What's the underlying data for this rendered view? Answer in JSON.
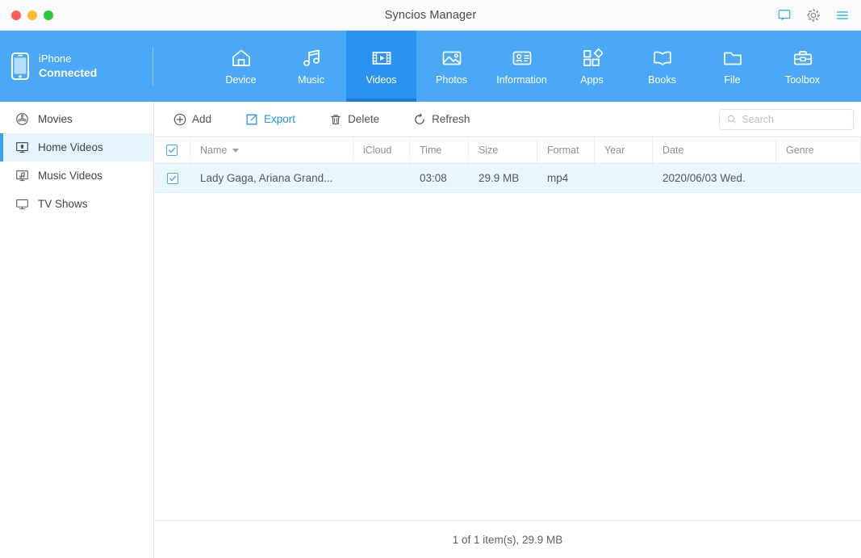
{
  "window": {
    "title": "Syncios Manager",
    "traffic_lights": [
      "close",
      "minimize",
      "maximize"
    ],
    "actions": [
      {
        "name": "feedback-icon",
        "label": "Feedback",
        "color": "#32b2f0"
      },
      {
        "name": "gear-icon",
        "label": "Settings",
        "color": "#8a9096"
      },
      {
        "name": "menu-icon",
        "label": "Menu",
        "color": "#32b2f0"
      }
    ]
  },
  "device": {
    "icon": "phone-icon",
    "name": "iPhone",
    "status": "Connected"
  },
  "nav": {
    "active": "Videos",
    "items": [
      {
        "label": "Device",
        "icon": "home-icon"
      },
      {
        "label": "Music",
        "icon": "music-note-icon"
      },
      {
        "label": "Videos",
        "icon": "film-icon"
      },
      {
        "label": "Photos",
        "icon": "picture-icon"
      },
      {
        "label": "Information",
        "icon": "contact-card-icon"
      },
      {
        "label": "Apps",
        "icon": "apps-grid-icon"
      },
      {
        "label": "Books",
        "icon": "book-icon"
      },
      {
        "label": "File",
        "icon": "folder-icon"
      },
      {
        "label": "Toolbox",
        "icon": "toolbox-icon"
      }
    ]
  },
  "sidebar": {
    "active": "Home Videos",
    "items": [
      {
        "label": "Movies",
        "icon": "film-reel-icon"
      },
      {
        "label": "Home Videos",
        "icon": "home-video-icon"
      },
      {
        "label": "Music Videos",
        "icon": "music-video-icon"
      },
      {
        "label": "TV Shows",
        "icon": "monitor-icon"
      }
    ]
  },
  "toolbar": {
    "add_label": "Add",
    "export_label": "Export",
    "delete_label": "Delete",
    "refresh_label": "Refresh"
  },
  "search": {
    "placeholder": "Search",
    "value": ""
  },
  "table": {
    "select_all_checked": true,
    "sort_column": "Name",
    "sort_direction": "desc",
    "columns": [
      {
        "key": "checkbox",
        "label": ""
      },
      {
        "key": "name",
        "label": "Name"
      },
      {
        "key": "icloud",
        "label": "iCloud"
      },
      {
        "key": "time",
        "label": "Time"
      },
      {
        "key": "size",
        "label": "Size"
      },
      {
        "key": "format",
        "label": "Format"
      },
      {
        "key": "year",
        "label": "Year"
      },
      {
        "key": "date",
        "label": "Date"
      },
      {
        "key": "genre",
        "label": "Genre"
      }
    ],
    "rows": [
      {
        "checked": true,
        "name": "Lady Gaga, Ariana Grand...",
        "icloud": "",
        "time": "03:08",
        "size": "29.9 MB",
        "format": "mp4",
        "year": "",
        "date": "2020/06/03 Wed.",
        "genre": ""
      }
    ]
  },
  "status": {
    "summary": "1 of 1 item(s), 29.9 MB"
  },
  "colors": {
    "nav_blue": "#4aa8f7",
    "nav_active_blue": "#2b93ef",
    "accent": "#2196f3",
    "row_selected": "#e9f6fd",
    "sidebar_selected": "#e6f4fd"
  }
}
